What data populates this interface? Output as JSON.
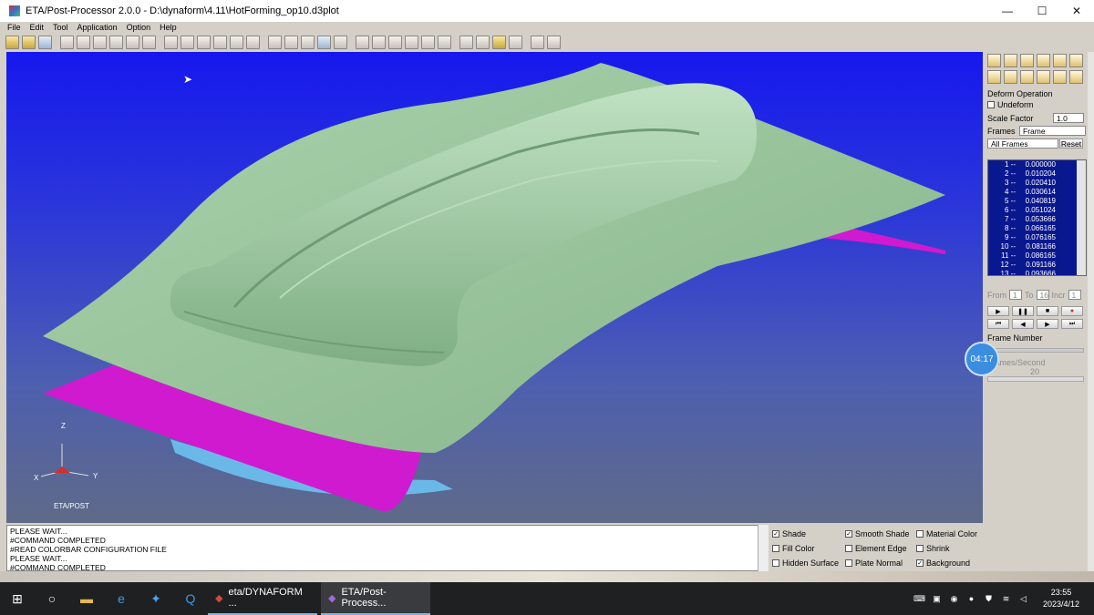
{
  "window": {
    "title": "ETA/Post-Processor 2.0.0 - D:\\dynaform\\4.11\\HotForming_op10.d3plot",
    "minimize": "—",
    "maximize": "☐",
    "close": "✕"
  },
  "menu": [
    "File",
    "Edit",
    "Tool",
    "Application",
    "Option",
    "Help"
  ],
  "viewport": {
    "axis_z": "Z",
    "axis_x": "X",
    "axis_y": "Y",
    "brand": "ETA/POST",
    "colors": {
      "background_top": "#1618ee",
      "sheet": "#9cc79f",
      "lower_die": "#d01ad0"
    }
  },
  "console": {
    "lines": [
      "PLEASE WAIT...",
      "#COMMAND COMPLETED",
      "#READ COLORBAR CONFIGURATION FILE",
      "PLEASE WAIT...",
      "#COMMAND COMPLETED"
    ]
  },
  "display_options": [
    {
      "label": "Shade",
      "checked": true
    },
    {
      "label": "Smooth Shade",
      "checked": true
    },
    {
      "label": "Material Color",
      "checked": false
    },
    {
      "label": "Fill Color",
      "checked": false
    },
    {
      "label": "Element Edge",
      "checked": false
    },
    {
      "label": "Shrink",
      "checked": false
    },
    {
      "label": "Hidden Surface",
      "checked": false
    },
    {
      "label": "Plate Normal",
      "checked": false
    },
    {
      "label": "Background",
      "checked": true
    }
  ],
  "panel": {
    "deform_label": "Deform Operation",
    "undeform_label": "Undeform",
    "scale_label": "Scale Factor",
    "scale_value": "1.0",
    "frames_label": "Frames",
    "frames_value": "Frame",
    "all_frames": "All Frames",
    "reset": "Reset",
    "frames": [
      {
        "i": "1 --",
        "v": "0.000000"
      },
      {
        "i": "2 --",
        "v": "0.010204"
      },
      {
        "i": "3 --",
        "v": "0.020410"
      },
      {
        "i": "4 --",
        "v": "0.030614"
      },
      {
        "i": "5 --",
        "v": "0.040819"
      },
      {
        "i": "6 --",
        "v": "0.051024"
      },
      {
        "i": "7 --",
        "v": "0.053666"
      },
      {
        "i": "8 --",
        "v": "0.066165"
      },
      {
        "i": "9 --",
        "v": "0.076165"
      },
      {
        "i": "10 --",
        "v": "0.081166"
      },
      {
        "i": "11 --",
        "v": "0.086165"
      },
      {
        "i": "12 --",
        "v": "0.091166"
      },
      {
        "i": "13 --",
        "v": "0.093666"
      }
    ],
    "from_label": "From",
    "from_value": "1",
    "to_label": "To",
    "to_value": "16",
    "incr_label": "Incr",
    "incr_value": "1",
    "frame_number_label": "Frame Number",
    "fps_label": "Frames/Second",
    "fps_value": "20"
  },
  "timer": "04:17",
  "taskbar": {
    "tasks": [
      {
        "label": "eta/DYNAFORM ..."
      },
      {
        "label": "ETA/Post-Process..."
      }
    ],
    "time": "23:55",
    "date": "2023/4/12"
  }
}
